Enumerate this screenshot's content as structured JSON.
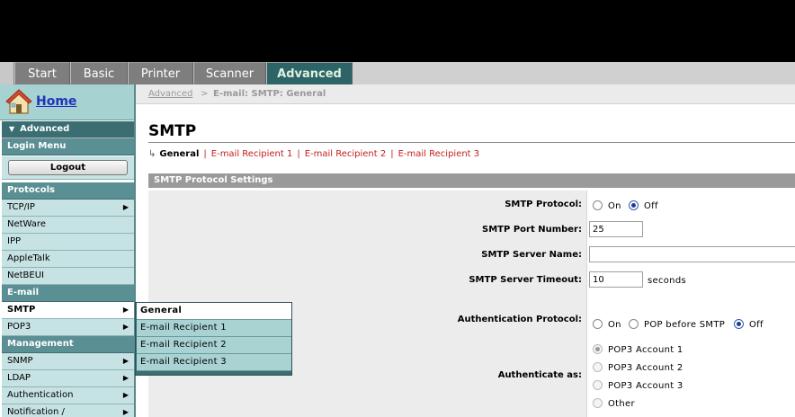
{
  "tabs": [
    {
      "label": "Start",
      "active": false
    },
    {
      "label": "Basic",
      "active": false
    },
    {
      "label": "Printer",
      "active": false
    },
    {
      "label": "Scanner",
      "active": false
    },
    {
      "label": "Advanced",
      "active": true
    }
  ],
  "sidebar": {
    "home_label": "Home",
    "advanced_header": "Advanced",
    "login_menu": "Login Menu",
    "logout_label": "Logout",
    "protocols_header": "Protocols",
    "protocols": [
      "TCP/IP",
      "NetWare",
      "IPP",
      "AppleTalk",
      "NetBEUI"
    ],
    "email_header": "E-mail",
    "email_items": [
      "SMTP",
      "POP3"
    ],
    "management_header": "Management",
    "management_items": [
      "SNMP",
      "LDAP",
      "Authentication",
      "Notification /"
    ]
  },
  "flyout": {
    "items": [
      "General",
      "E-mail Recipient 1",
      "E-mail Recipient 2",
      "E-mail Recipient 3"
    ],
    "selected": "General"
  },
  "breadcrumb": {
    "link": "Advanced",
    "separator": ">",
    "current": "E-mail: SMTP: General"
  },
  "page": {
    "title": "SMTP",
    "subnav": {
      "current": "General",
      "links": [
        "E-mail Recipient 1",
        "E-mail Recipient 2",
        "E-mail Recipient 3"
      ],
      "separator": "|"
    },
    "section_title": "SMTP Protocol Settings",
    "fields": {
      "smtp_protocol": {
        "label": "SMTP Protocol:",
        "options": [
          "On",
          "Off"
        ],
        "selected": "Off"
      },
      "port": {
        "label": "SMTP Port Number:",
        "value": "25"
      },
      "server_name": {
        "label": "SMTP Server Name:",
        "value": ""
      },
      "timeout": {
        "label": "SMTP Server Timeout:",
        "value": "10",
        "unit": "seconds"
      },
      "auth_protocol": {
        "label": "Authentication Protocol:",
        "options": [
          "On",
          "POP before SMTP",
          "Off"
        ],
        "selected": "Off"
      },
      "authenticate_as": {
        "label": "Authenticate as:",
        "options": [
          "POP3 Account 1",
          "POP3 Account 2",
          "POP3 Account 3",
          "Other"
        ],
        "selected": "POP3 Account 1"
      }
    }
  },
  "colors": {
    "accent": "#2d6468",
    "sidebar_item": "#c6e2e2",
    "section": "#5a8f94",
    "link_red": "#c41e1e"
  }
}
